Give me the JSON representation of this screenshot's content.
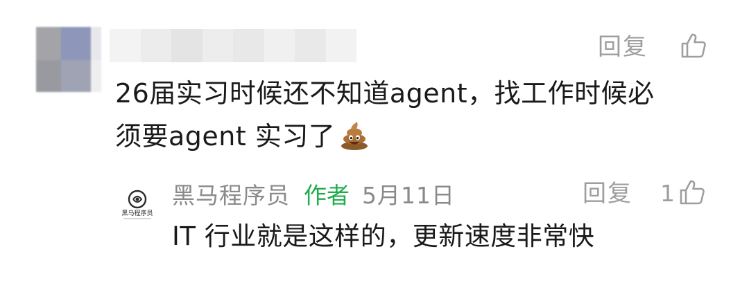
{
  "comment": {
    "avatar": "blurred-avatar",
    "username": "",
    "reply_label": "回复",
    "like_icon": "thumbs-up-icon",
    "like_count": "",
    "text_line1": "26届实习时候还不知道agent，找工作时候必",
    "text_line2": "须要agent 实习了",
    "emoji": "pile-of-poo-emoji"
  },
  "reply": {
    "avatar": "heima-logo",
    "avatar_text": "黑马程序员",
    "author_name": "黑马程序员",
    "author_badge": "作者",
    "date": "5月11日",
    "reply_label": "回复",
    "like_icon": "thumbs-up-icon",
    "like_count": "1",
    "text": "IT 行业就是这样的，更新速度非常快"
  },
  "colors": {
    "meta_gray": "#9e9e9e",
    "author_green": "#1fad4c",
    "text": "#1a1a1a"
  }
}
